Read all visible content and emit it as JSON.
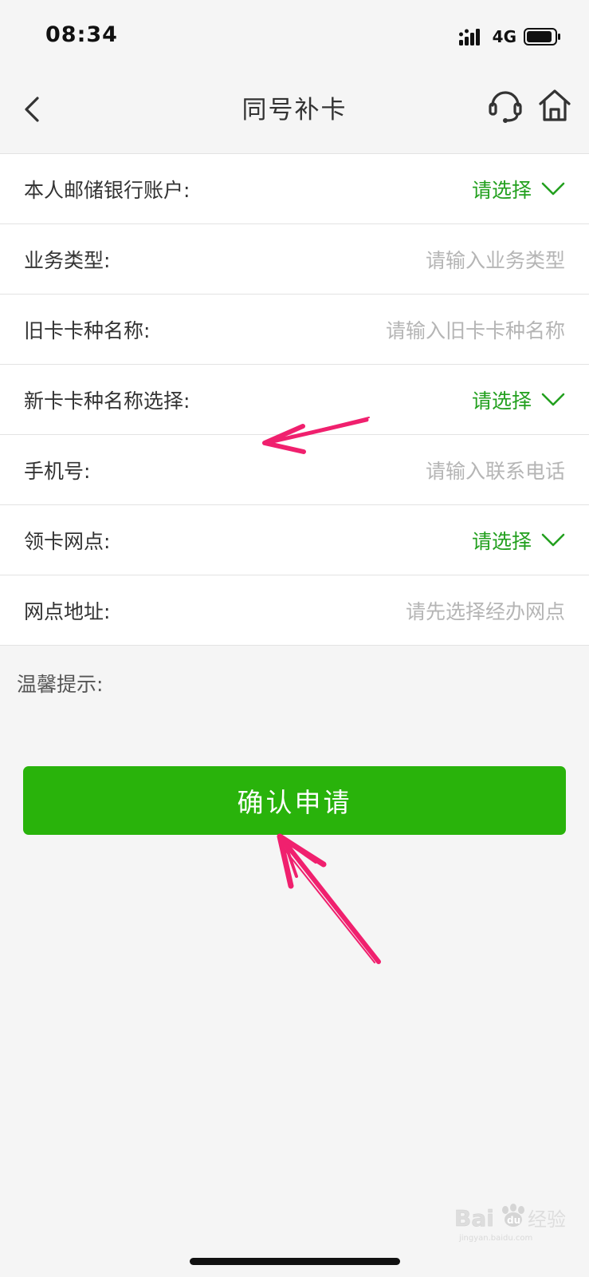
{
  "status_bar": {
    "time": "08:34",
    "network": "4G",
    "icons": [
      "signal-bars-icon",
      "battery-icon"
    ]
  },
  "nav": {
    "title": "同号补卡",
    "icons": [
      "back-arrow-icon",
      "customer-service-headset-icon",
      "home-icon"
    ]
  },
  "form": {
    "rows": [
      {
        "label": "本人邮储银行账户:",
        "value": "请选择",
        "type": "select"
      },
      {
        "label": "业务类型:",
        "value": "请输入业务类型",
        "type": "input"
      },
      {
        "label": "旧卡卡种名称:",
        "value": "请输入旧卡卡种名称",
        "type": "input"
      },
      {
        "label": "新卡卡种名称选择:",
        "value": "请选择",
        "type": "select"
      },
      {
        "label": "手机号:",
        "value": "请输入联系电话",
        "type": "input"
      },
      {
        "label": "领卡网点:",
        "value": "请选择",
        "type": "select"
      },
      {
        "label": "网点地址:",
        "value": "请先选择经办网点",
        "type": "input"
      }
    ]
  },
  "tip": {
    "label": "温馨提示:"
  },
  "submit": {
    "label": "确认申请"
  },
  "watermark": {
    "text": "Baidu经验",
    "url_text": "jingyan.baidu.com"
  },
  "colors": {
    "accent_green": "#29b30b",
    "select_green": "#23a01f",
    "annotation_arrow": "#f0206e",
    "placeholder_gray": "#b5b5b5",
    "background": "#f5f5f5"
  }
}
